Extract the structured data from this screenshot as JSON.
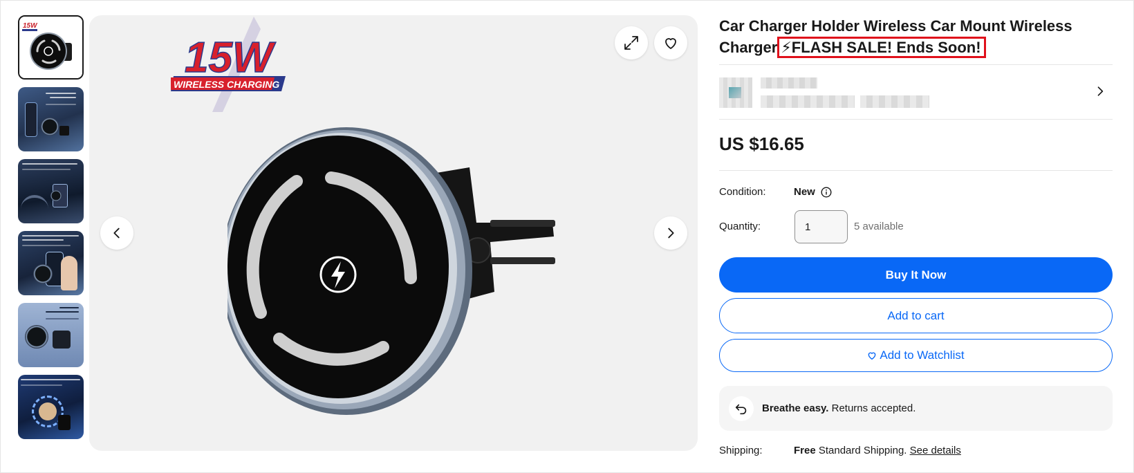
{
  "listing": {
    "title_main": "Car Charger Holder Wireless Car Mount Wireless Charger",
    "title_flash": "⚡FLASH SALE! Ends Soon!",
    "badge_text": "15W",
    "badge_subtext": "WIRELESS CHARGING",
    "price": "US $16.65"
  },
  "details": {
    "condition_label": "Condition:",
    "condition_value": "New",
    "quantity_label": "Quantity:",
    "quantity_value": "1",
    "quantity_available": "5 available",
    "shipping_label": "Shipping:",
    "shipping_free": "Free",
    "shipping_text": "Standard Shipping.",
    "shipping_link": "See details"
  },
  "actions": {
    "buy_now": "Buy It Now",
    "add_to_cart": "Add to cart",
    "add_to_watchlist": "Add to Watchlist"
  },
  "returns": {
    "bold": "Breathe easy.",
    "text": "Returns accepted."
  },
  "gallery": {
    "thumbnail_count": 6,
    "selected_index": 0
  },
  "colors": {
    "accent_blue": "#0968f6",
    "flash_border": "#e0101b",
    "badge_red": "#d8202c",
    "badge_blue": "#2b3a8c"
  },
  "icons": {
    "expand": "expand-icon",
    "heart": "heart-icon",
    "prev": "chevron-left-icon",
    "next": "chevron-right-icon",
    "info": "info-icon",
    "returns": "return-arrow-icon"
  }
}
